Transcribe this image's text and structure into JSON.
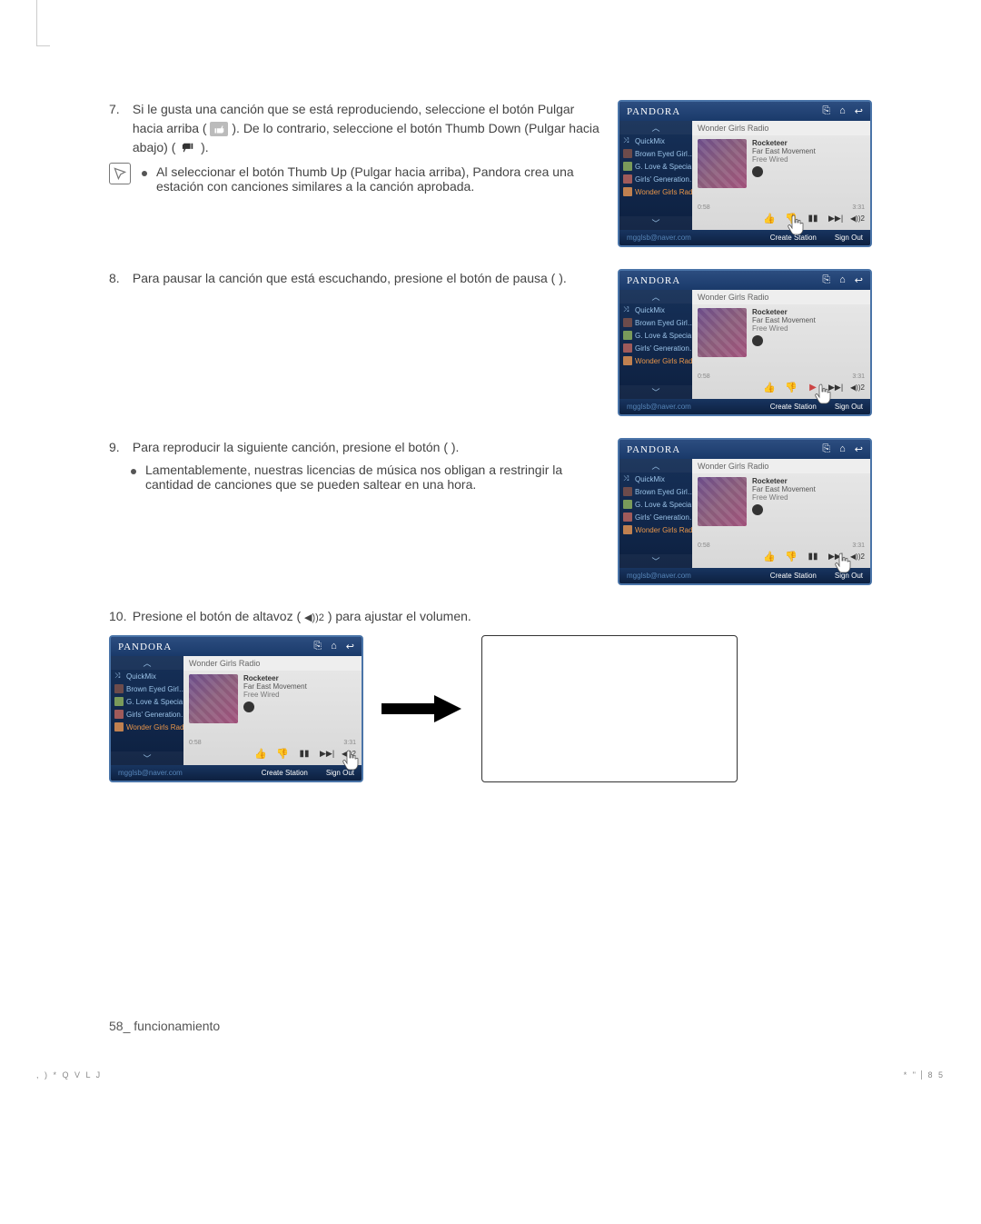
{
  "steps": {
    "s7": {
      "num": "7.",
      "text_a": "Si le gusta una canción que se está reproduciendo, seleccione el botón Pulgar hacia arriba (",
      "text_b": "). De lo contrario, seleccione el botón Thumb Down (Pulgar hacia abajo) (",
      "text_c": ")."
    },
    "s7_note": "Al seleccionar el botón Thumb Up (Pulgar hacia arriba), Pandora crea una estación con canciones similares a la canción aprobada.",
    "s8": {
      "num": "8.",
      "text_a": "Para pausar la canción que está escuchando, presione el botón de pausa (",
      "text_b": ")."
    },
    "s9": {
      "num": "9.",
      "text_a": "Para reproducir la siguiente canción, presione el botón (",
      "text_b": ")."
    },
    "s9_note": "Lamentablemente, nuestras licencias de música nos obligan a restringir la cantidad de canciones que se pueden saltear en una hora.",
    "s10": {
      "num": "10.",
      "text_a": "Presione el botón de altavoz (",
      "text_b": ") para ajustar el volumen."
    }
  },
  "pandora": {
    "logo": "PANDORA",
    "station_title": "Wonder Girls Radio",
    "sidebar": {
      "quickmix": "QuickMix",
      "items": [
        "Brown Eyed Girl…",
        "G. Love & Specia…",
        "Girls' Generation…",
        "Wonder Girls Radio"
      ]
    },
    "track": {
      "title": "Rocketeer",
      "artist": "Far East Movement",
      "album": "Free Wired",
      "elapsed": "0:58",
      "total": "3:31"
    },
    "icons": {
      "new_station": "⎘",
      "home": "⌂",
      "back": "↩",
      "shuffle": "⤨",
      "up": "︿",
      "down": "﹀",
      "thumb_up": "👍",
      "thumb_down": "👎",
      "pause": "▮▮",
      "play": "▶",
      "next": "▶▶|",
      "speaker": "◀))2"
    },
    "footer": {
      "email": "mgglsb@naver.com",
      "create": "Create Station",
      "signout": "Sign Out"
    }
  },
  "page_footer": "58_ funcionamiento",
  "bottom": {
    "left": ", )      *  Q V L J",
    "right_a": "*   \"",
    "right_b": "8 5"
  }
}
